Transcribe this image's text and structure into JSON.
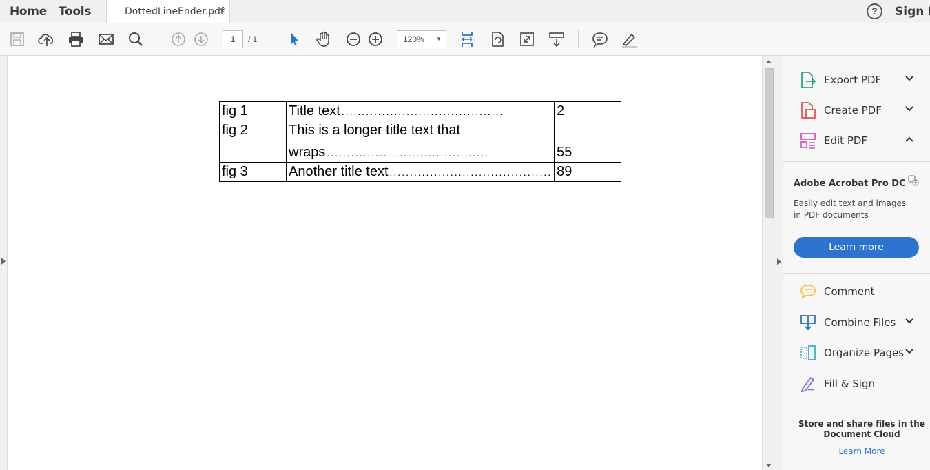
{
  "topbar": {
    "home": "Home",
    "tools": "Tools",
    "tab_title": "DottedLineEnder.pdf",
    "tab_close": "×",
    "help": "?",
    "sign_in": "Sign In"
  },
  "toolbar": {
    "page_current": "1",
    "page_total": "/ 1",
    "zoom": "120%",
    "icons": [
      "save-icon",
      "upload-cloud-icon",
      "print-icon",
      "email-icon",
      "search-icon",
      "page-up-icon",
      "page-down-icon",
      "select-cursor-icon",
      "hand-icon",
      "zoom-out-icon",
      "zoom-in-icon",
      "fit-page-icon",
      "rotate-icon",
      "fullscreen-icon",
      "scroll-mode-icon",
      "comment-icon",
      "highlight-icon"
    ]
  },
  "document": {
    "rows": [
      {
        "fig": "fig 1",
        "title": "Title text",
        "page": "2"
      },
      {
        "fig": "fig 2",
        "title_line1": "This is a longer title text that",
        "title_line2": "wraps",
        "page": "55"
      },
      {
        "fig": "fig 3",
        "title": "Another title text",
        "page": "89"
      }
    ],
    "dots": "........................................"
  },
  "right_panel": {
    "tools_top": [
      {
        "label": "Export PDF",
        "icon": "export-pdf-icon",
        "expanded": false
      },
      {
        "label": "Create PDF",
        "icon": "create-pdf-icon",
        "expanded": false
      },
      {
        "label": "Edit PDF",
        "icon": "edit-pdf-icon",
        "expanded": true
      }
    ],
    "promo": {
      "title": "Adobe Acrobat Pro DC",
      "text": "Easily edit text and images in PDF documents",
      "button": "Learn more"
    },
    "tools_bottom": [
      {
        "label": "Comment",
        "icon": "comment-icon"
      },
      {
        "label": "Combine Files",
        "icon": "combine-files-icon"
      },
      {
        "label": "Organize Pages",
        "icon": "organize-pages-icon"
      },
      {
        "label": "Fill & Sign",
        "icon": "fill-sign-icon"
      }
    ],
    "cloud": {
      "text": "Store and share files in the Document Cloud",
      "link": "Learn More"
    }
  },
  "colors": {
    "accent": "#2d73d0",
    "export": "#2aa37e",
    "create": "#e05a4f",
    "edit": "#d957c4",
    "comment": "#f5c342",
    "combine": "#2d73d0",
    "organize": "#3ab0c9",
    "fill_sign": "#8a6cd8"
  }
}
